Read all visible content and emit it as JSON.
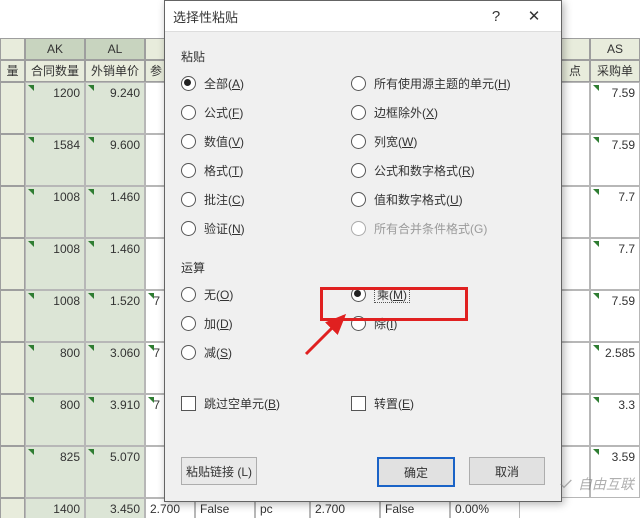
{
  "columns": {
    "first_hdr": "量",
    "ak": "AK",
    "al": "AL",
    "am": "参",
    "as": "AS",
    "hdrs": [
      "合同数量",
      "外销单价",
      "参",
      "点",
      "采购单价"
    ]
  },
  "rows": [
    {
      "ak": "1200",
      "al": "9.240",
      "am": "",
      "as": "7.59"
    },
    {
      "ak": "1584",
      "al": "9.600",
      "am": "",
      "as": "7.59"
    },
    {
      "ak": "1008",
      "al": "1.460",
      "am": "",
      "as": "7.7"
    },
    {
      "ak": "1008",
      "al": "1.460",
      "am": "",
      "as": "7.7"
    },
    {
      "ak": "1008",
      "al": "1.520",
      "am": "7",
      "as": "7.59"
    },
    {
      "ak": "800",
      "al": "3.060",
      "am": "7",
      "as": "2.585"
    },
    {
      "ak": "800",
      "al": "3.910",
      "am": "7",
      "as": "3.3"
    },
    {
      "ak": "825",
      "al": "5.070",
      "am": "",
      "as": "3.59"
    },
    {
      "ak": "1400",
      "al": "3.450",
      "am": "2.700",
      "f1": "False",
      "f2": "pc",
      "v2": "2.700",
      "f3": "False",
      "pct": "0.00%",
      "as": ""
    }
  ],
  "dialog": {
    "title": "选择性粘贴",
    "help": "?",
    "close": "✕",
    "sections": {
      "paste": "粘贴",
      "operation": "运算"
    },
    "paste_left": [
      {
        "label": "全部(",
        "u": "A",
        "tail": ")",
        "checked": true
      },
      {
        "label": "公式(",
        "u": "F",
        "tail": ")"
      },
      {
        "label": "数值(",
        "u": "V",
        "tail": ")"
      },
      {
        "label": "格式(",
        "u": "T",
        "tail": ")"
      },
      {
        "label": "批注(",
        "u": "C",
        "tail": ")"
      },
      {
        "label": "验证(",
        "u": "N",
        "tail": ")"
      }
    ],
    "paste_right": [
      {
        "label": "所有使用源主题的单元(",
        "u": "H",
        "tail": ")"
      },
      {
        "label": "边框除外(",
        "u": "X",
        "tail": ")"
      },
      {
        "label": "列宽(",
        "u": "W",
        "tail": ")"
      },
      {
        "label": "公式和数字格式(",
        "u": "R",
        "tail": ")"
      },
      {
        "label": "值和数字格式(",
        "u": "U",
        "tail": ")"
      },
      {
        "label": "所有合并条件格式(G)",
        "disabled": true
      }
    ],
    "op_left": [
      {
        "label": "无(",
        "u": "O",
        "tail": ")"
      },
      {
        "label": "加(",
        "u": "D",
        "tail": ")"
      },
      {
        "label": "减(",
        "u": "S",
        "tail": ")"
      }
    ],
    "op_right": [
      {
        "label": "乘(",
        "u": "M",
        "tail": ")",
        "checked": true,
        "highlight": true
      },
      {
        "label": "除(",
        "u": "I",
        "tail": ")"
      }
    ],
    "skip_blanks": {
      "label": "跳过空单元(",
      "u": "B",
      "tail": ")"
    },
    "transpose": {
      "label": "转置(",
      "u": "E",
      "tail": ")"
    },
    "paste_link": "粘贴链接 (L)",
    "ok": "确定",
    "cancel": "取消"
  },
  "watermark": "自由互联"
}
